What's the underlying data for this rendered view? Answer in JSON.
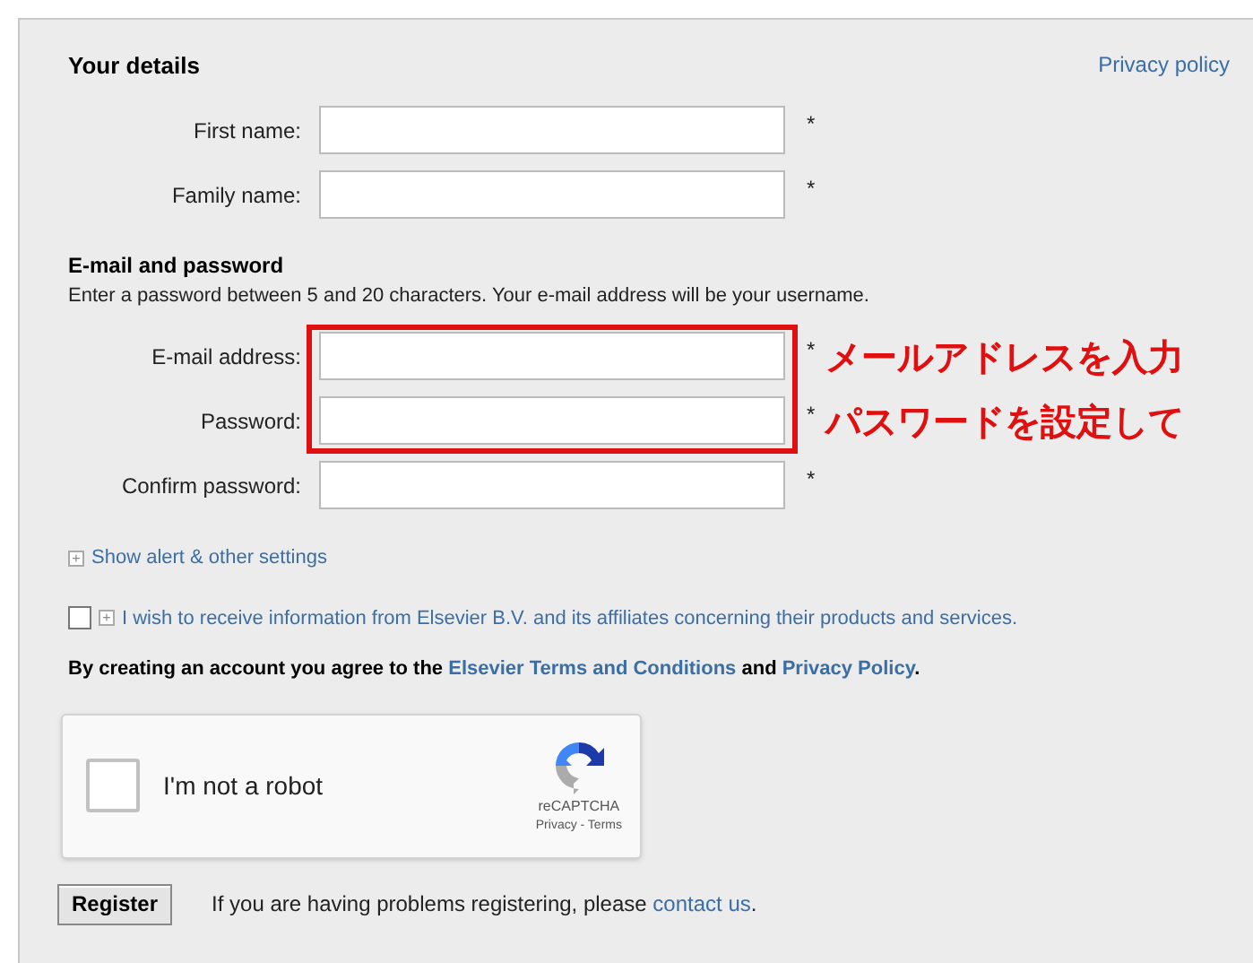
{
  "privacy_link": "Privacy policy",
  "details": {
    "heading": "Your details",
    "fields": [
      {
        "label": "First name:",
        "required": "*"
      },
      {
        "label": "Family name:",
        "required": "*"
      }
    ]
  },
  "credentials": {
    "heading": "E-mail and password",
    "hint": "Enter a password between 5 and 20 characters. Your e-mail address will be your username.",
    "fields": [
      {
        "label": "E-mail address:",
        "required": "*",
        "highlighted": true,
        "annotation": "メールアドレスを入力"
      },
      {
        "label": "Password:",
        "required": "*",
        "highlighted": true,
        "annotation": "パスワードを設定して"
      },
      {
        "label": "Confirm password:",
        "required": "*",
        "highlighted": false
      }
    ]
  },
  "alert_toggle": {
    "icon": "+",
    "label": "Show alert & other settings"
  },
  "newsletter": {
    "checked": false,
    "icon": "+",
    "label": "I wish to receive information from Elsevier B.V. and its affiliates concerning their products and services."
  },
  "agreement": {
    "text": "By creating an account you agree to the",
    "terms_link": "Elsevier Terms and Conditions",
    "joiner": "and",
    "privacy_link": "Privacy Policy",
    "end": "."
  },
  "captcha": {
    "checked": false,
    "label": "I'm not a robot",
    "brand": "reCAPTCHA",
    "links": "Privacy - Terms"
  },
  "register_button": "Register",
  "help": {
    "text": "If you are having problems registering, please",
    "link": "contact us",
    "end": "."
  }
}
